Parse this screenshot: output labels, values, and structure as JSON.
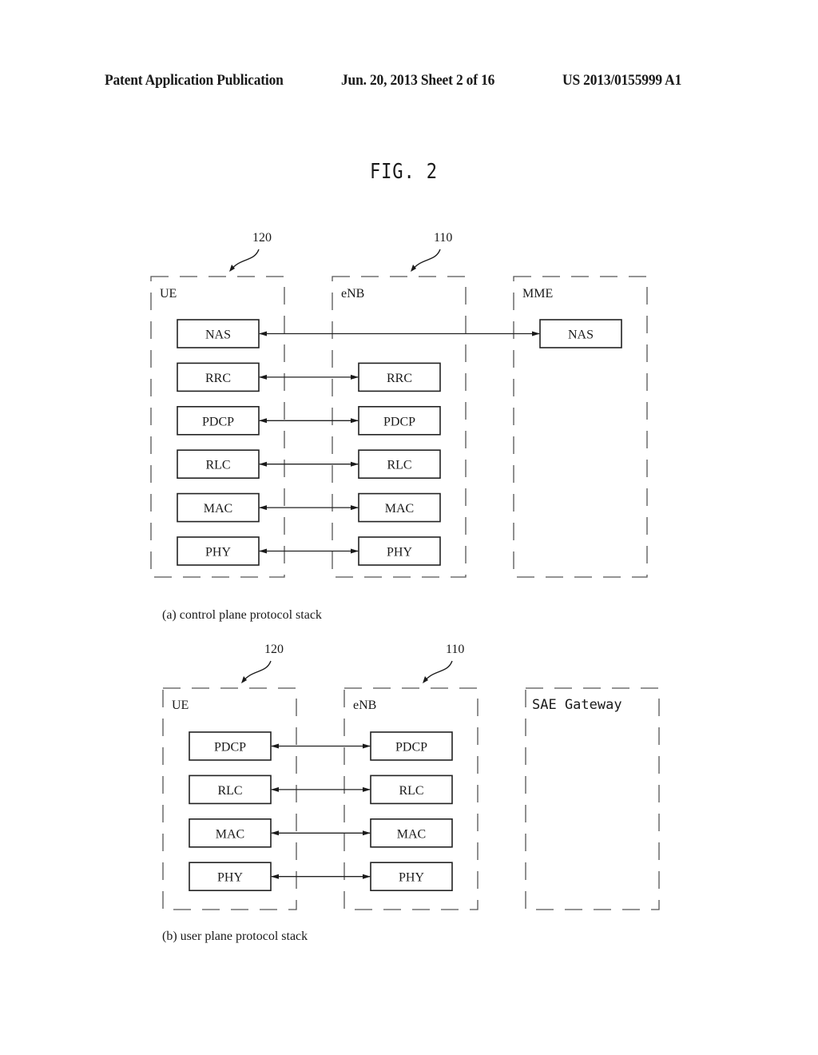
{
  "header": {
    "publication": "Patent Application Publication",
    "date_sheet": "Jun. 20, 2013  Sheet 2 of 16",
    "patent_number": "US 2013/0155999 A1"
  },
  "figure": {
    "title": "FIG. 2"
  },
  "panel_a": {
    "caption": "(a) control plane protocol stack",
    "entities": [
      {
        "id": "ue",
        "label": "UE",
        "ref": "120"
      },
      {
        "id": "enb",
        "label": "eNB",
        "ref": "110"
      },
      {
        "id": "mme",
        "label": "MME",
        "ref": ""
      }
    ],
    "layers": [
      {
        "name": "NAS",
        "from": "ue",
        "to": "mme"
      },
      {
        "name": "RRC",
        "from": "ue",
        "to": "enb"
      },
      {
        "name": "PDCP",
        "from": "ue",
        "to": "enb"
      },
      {
        "name": "RLC",
        "from": "ue",
        "to": "enb"
      },
      {
        "name": "MAC",
        "from": "ue",
        "to": "enb"
      },
      {
        "name": "PHY",
        "from": "ue",
        "to": "enb"
      }
    ]
  },
  "panel_b": {
    "caption": "(b) user plane protocol stack",
    "entities": [
      {
        "id": "ue",
        "label": "UE",
        "ref": "120"
      },
      {
        "id": "enb",
        "label": "eNB",
        "ref": "110"
      },
      {
        "id": "gw",
        "label": "SAE Gateway",
        "ref": ""
      }
    ],
    "layers": [
      {
        "name": "PDCP",
        "from": "ue",
        "to": "enb"
      },
      {
        "name": "RLC",
        "from": "ue",
        "to": "enb"
      },
      {
        "name": "MAC",
        "from": "ue",
        "to": "enb"
      },
      {
        "name": "PHY",
        "from": "ue",
        "to": "enb"
      }
    ]
  }
}
